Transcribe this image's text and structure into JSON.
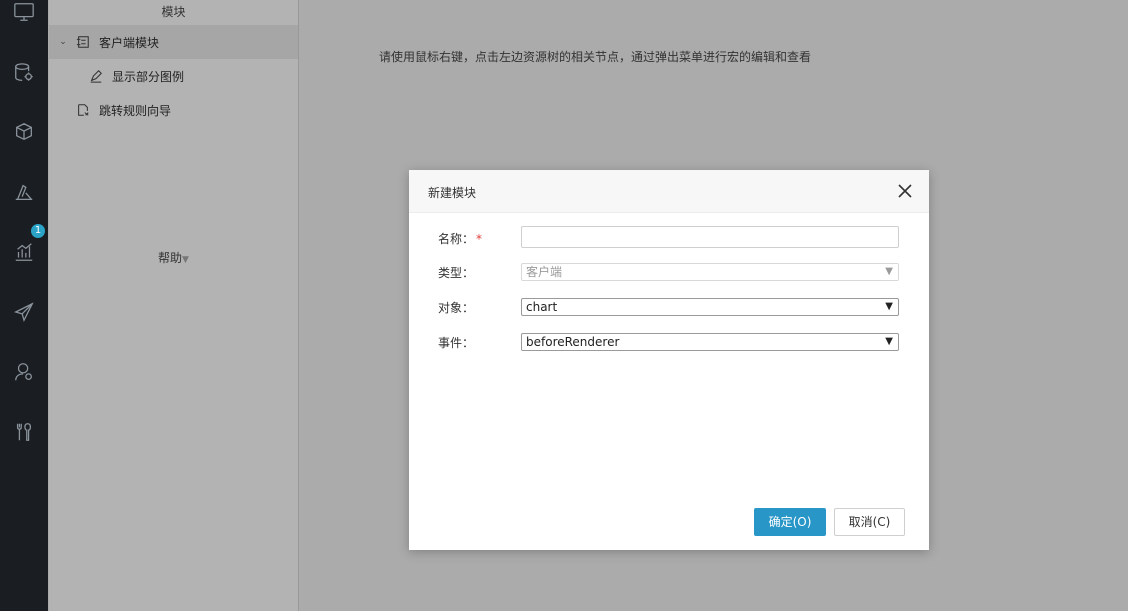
{
  "sidebar": {
    "icons": [
      "monitor-icon",
      "database-gear-icon",
      "cubes-icon",
      "ruler-tool-icon",
      "bar-chart-icon",
      "paper-plane-icon",
      "user-gear-icon",
      "tools-icon"
    ],
    "badge": "1"
  },
  "tree": {
    "header": "模块",
    "items": [
      {
        "label": "客户端模块",
        "expanded": true,
        "icon": "module-icon"
      },
      {
        "label": "显示部分图例",
        "icon": "edit-icon"
      },
      {
        "label": "跳转规则向导",
        "icon": "wizard-icon"
      }
    ],
    "help_label": "帮助"
  },
  "main": {
    "hint": "请使用鼠标右键，点击左边资源树的相关节点，通过弹出菜单进行宏的编辑和查看"
  },
  "dialog": {
    "title": "新建模块",
    "fields": {
      "name_label": "名称：",
      "name_required": "*",
      "name_value": "",
      "type_label": "类型：",
      "type_value": "客户端",
      "object_label": "对象：",
      "object_value": "chart",
      "event_label": "事件：",
      "event_value": "beforeRenderer"
    },
    "ok_label": "确定(O)",
    "cancel_label": "取消(C)"
  },
  "colors": {
    "rail": "#1a1e23",
    "accent": "#2996c8",
    "badge": "#2aa3c7",
    "required": "#e23c3c"
  }
}
